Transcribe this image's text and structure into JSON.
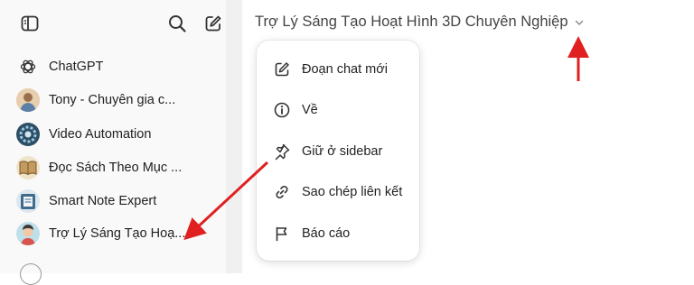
{
  "sidebar": {
    "toggle_icon": "sidebar-toggle-icon",
    "search_icon": "search-icon",
    "new_chat_icon": "edit-icon",
    "items": [
      {
        "label": "ChatGPT",
        "icon": "openai-logo-icon"
      },
      {
        "label": "Tony - Chuyên gia c...",
        "icon": "avatar-tony"
      },
      {
        "label": "Video Automation",
        "icon": "avatar-video-automation"
      },
      {
        "label": "Đọc Sách Theo Mục ...",
        "icon": "avatar-book"
      },
      {
        "label": "Smart Note Expert",
        "icon": "avatar-smart-note"
      },
      {
        "label": "Trợ Lý Sáng Tạo Hoạ...",
        "icon": "avatar-creative-assistant"
      }
    ]
  },
  "header": {
    "title": "Trợ Lý Sáng Tạo Hoạt Hình 3D Chuyên Nghiệp",
    "chevron_icon": "chevron-down-icon"
  },
  "menu": {
    "items": [
      {
        "label": "Đoạn chat mới",
        "icon": "edit-icon"
      },
      {
        "label": "Về",
        "icon": "info-icon"
      },
      {
        "label": "Giữ ở sidebar",
        "icon": "pin-icon"
      },
      {
        "label": "Sao chép liên kết",
        "icon": "link-icon"
      },
      {
        "label": "Báo cáo",
        "icon": "flag-icon"
      }
    ]
  },
  "annotations": {
    "arrow_color": "#e02020"
  }
}
